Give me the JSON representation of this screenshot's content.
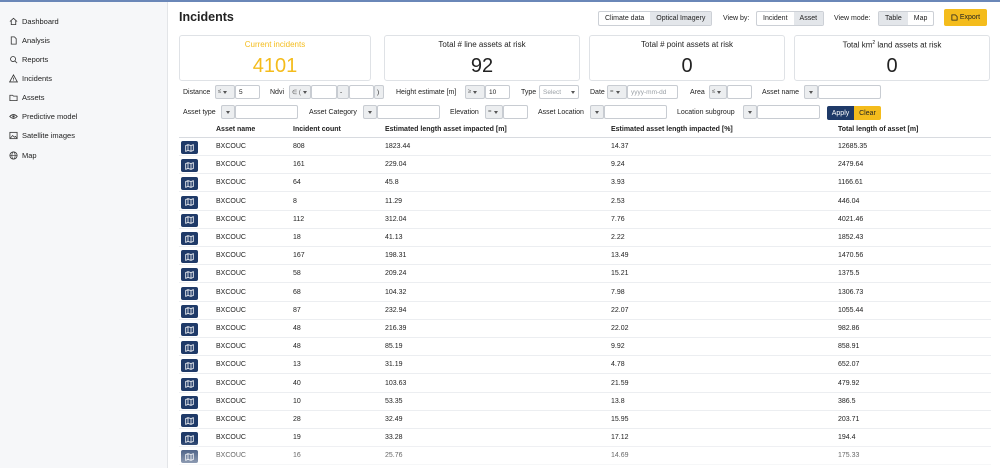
{
  "sidebar": {
    "items": [
      {
        "label": "Dashboard",
        "icon": "home-icon"
      },
      {
        "label": "Analysis",
        "icon": "file-icon"
      },
      {
        "label": "Reports",
        "icon": "search-document-icon"
      },
      {
        "label": "Incidents",
        "icon": "warning-triangle-icon"
      },
      {
        "label": "Assets",
        "icon": "folder-icon"
      },
      {
        "label": "Predictive model",
        "icon": "eye-icon"
      },
      {
        "label": "Satellite images",
        "icon": "image-icon"
      },
      {
        "label": "Map",
        "icon": "globe-icon"
      }
    ]
  },
  "header": {
    "title": "Incidents",
    "data_toggle": [
      "Climate data",
      "Optical Imagery"
    ],
    "view_by_label": "View by:",
    "view_by": [
      "Incident",
      "Asset"
    ],
    "view_mode_label": "View mode:",
    "view_mode": [
      "Table",
      "Map"
    ],
    "export_label": "Export"
  },
  "cards": [
    {
      "title": "Current incidents",
      "value": "4101"
    },
    {
      "title": "Total # line assets at risk",
      "value": "92"
    },
    {
      "title": "Total # point assets at risk",
      "value": "0"
    },
    {
      "title": "Total km",
      "title_sup": "2",
      "title_suffix": " land assets at risk",
      "value": "0"
    }
  ],
  "filters": {
    "distance": {
      "label": "Distance",
      "op": "≤",
      "value": "5"
    },
    "ndvi": {
      "label": "Ndvi",
      "op": "∈ (",
      "sep": "-",
      "close": ")"
    },
    "height": {
      "label": "Height estimate [m]",
      "op": "≥",
      "value": "10"
    },
    "type": {
      "label": "Type",
      "placeholder": "Select"
    },
    "date": {
      "label": "Date",
      "op": "=",
      "placeholder": "yyyy-mm-dd"
    },
    "area": {
      "label": "Area",
      "op": "≤"
    },
    "asset_name": {
      "label": "Asset name"
    },
    "asset_type": {
      "label": "Asset type"
    },
    "asset_category": {
      "label": "Asset Category"
    },
    "elevation": {
      "label": "Elevation",
      "op": "="
    },
    "asset_location": {
      "label": "Asset Location"
    },
    "location_subgroup": {
      "label": "Location subgroup"
    },
    "apply_label": "Apply",
    "clear_label": "Clear"
  },
  "table": {
    "columns": [
      "Asset name",
      "Incident count",
      "Estimated length asset impacted [m]",
      "Estimated asset length impacted [%]",
      "Total length of asset [m]"
    ],
    "rows": [
      [
        "BXCOUC",
        "808",
        "1823.44",
        "14.37",
        "12685.35"
      ],
      [
        "BXCOUC",
        "161",
        "229.04",
        "9.24",
        "2479.64"
      ],
      [
        "BXCOUC",
        "64",
        "45.8",
        "3.93",
        "1166.61"
      ],
      [
        "BXCOUC",
        "8",
        "11.29",
        "2.53",
        "446.04"
      ],
      [
        "BXCOUC",
        "112",
        "312.04",
        "7.76",
        "4021.46"
      ],
      [
        "BXCOUC",
        "18",
        "41.13",
        "2.22",
        "1852.43"
      ],
      [
        "BXCOUC",
        "167",
        "198.31",
        "13.49",
        "1470.56"
      ],
      [
        "BXCOUC",
        "58",
        "209.24",
        "15.21",
        "1375.5"
      ],
      [
        "BXCOUC",
        "68",
        "104.32",
        "7.98",
        "1306.73"
      ],
      [
        "BXCOUC",
        "87",
        "232.94",
        "22.07",
        "1055.44"
      ],
      [
        "BXCOUC",
        "48",
        "216.39",
        "22.02",
        "982.86"
      ],
      [
        "BXCOUC",
        "48",
        "85.19",
        "9.92",
        "858.91"
      ],
      [
        "BXCOUC",
        "13",
        "31.19",
        "4.78",
        "652.07"
      ],
      [
        "BXCOUC",
        "40",
        "103.63",
        "21.59",
        "479.92"
      ],
      [
        "BXCOUC",
        "10",
        "53.35",
        "13.8",
        "386.5"
      ],
      [
        "BXCOUC",
        "28",
        "32.49",
        "15.95",
        "203.71"
      ],
      [
        "BXCOUC",
        "19",
        "33.28",
        "17.12",
        "194.4"
      ],
      [
        "BXCOUC",
        "16",
        "25.76",
        "14.69",
        "175.33"
      ]
    ]
  },
  "colors": {
    "accent": "#f4bc1c",
    "primary": "#1f3a68"
  }
}
